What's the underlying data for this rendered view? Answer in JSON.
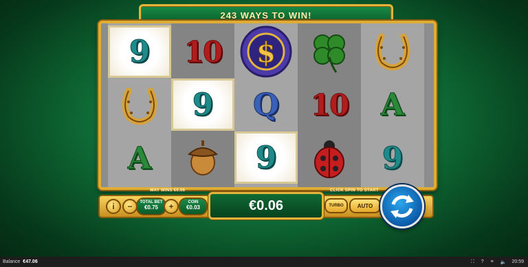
{
  "banner": {
    "title": "243 WAYS TO WIN!"
  },
  "reels": [
    [
      "9",
      "horseshoe",
      "A"
    ],
    [
      "10",
      "9",
      "acorn"
    ],
    [
      "dollar-chip",
      "Q",
      "9"
    ],
    [
      "clover",
      "10",
      "ladybug"
    ],
    [
      "horseshoe",
      "A",
      "9"
    ]
  ],
  "winning_cells": [
    [
      0,
      0
    ],
    [
      1,
      1
    ],
    [
      2,
      2
    ]
  ],
  "labels": {
    "way_wins": "WAY WINS €0.06",
    "click_spin": "CLICK SPIN TO START",
    "total_bet_label": "TOTAL BET",
    "total_bet_value": "€0.75",
    "coin_label": "COIN",
    "coin_value": "€0.03",
    "win_amount": "€0.06",
    "turbo": "TURBO",
    "auto": "AUTO",
    "info": "i",
    "minus": "−",
    "plus": "+"
  },
  "status": {
    "balance_label": "Balance",
    "balance_value": "€47.06",
    "time": "20:59",
    "help": "?"
  },
  "colors": {
    "gold": "#e2b43a",
    "green_bg": "#0f6e37",
    "spin_blue": "#1e88d8"
  }
}
